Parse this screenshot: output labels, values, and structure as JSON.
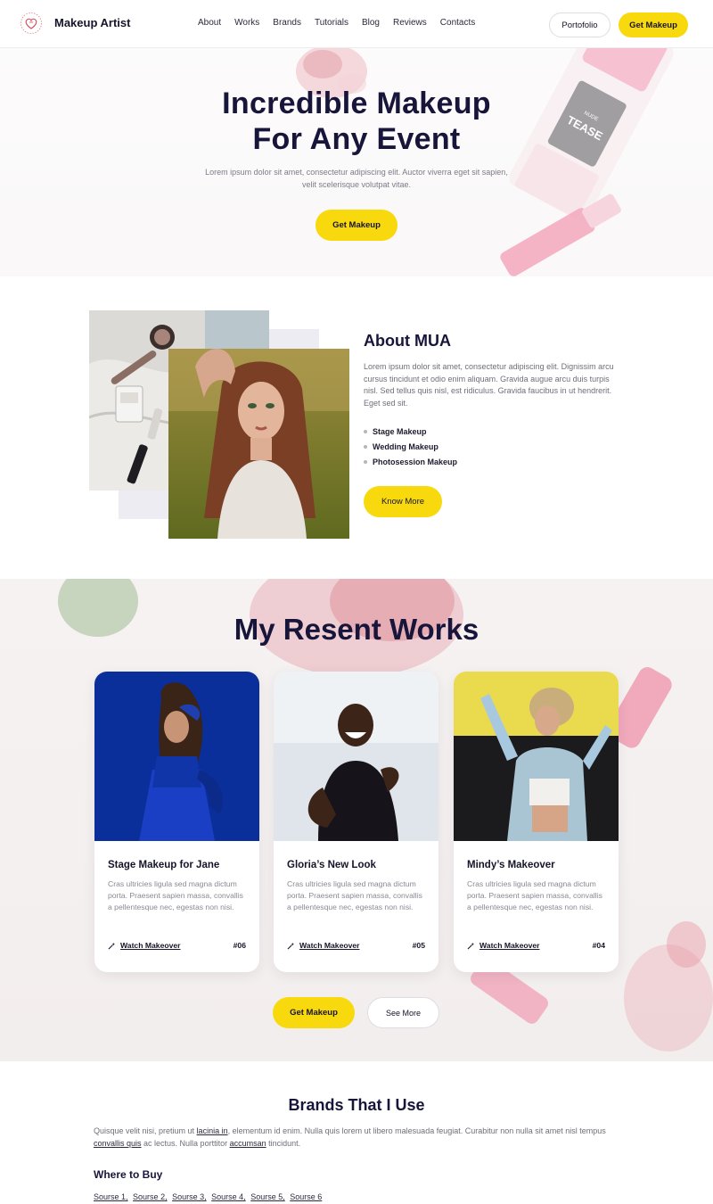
{
  "header": {
    "brand": "Makeup Artist",
    "logo_icon": "heart-outline-icon",
    "nav": [
      "About",
      "Works",
      "Brands",
      "Tutorials",
      "Blog",
      "Reviews",
      "Contacts"
    ],
    "portfolio_label": "Portofolio",
    "get_makeup_label": "Get Makeup"
  },
  "hero": {
    "title_line1": "Incredible Makeup",
    "title_line2": "For Any Event",
    "subtitle": "Lorem ipsum dolor sit amet, consectetur adipiscing elit. Auctor viverra eget sit sapien, velit scelerisque volutpat vitae.",
    "cta_label": "Get Makeup",
    "product_label": "TEASE"
  },
  "about": {
    "title": "About MUA",
    "text": "Lorem ipsum dolor sit amet, consectetur adipiscing elit. Dignissim arcu cursus tincidunt et odio enim aliquam. Gravida augue arcu duis turpis nisl. Sed tellus quis nisl, est ridiculus. Gravida faucibus in ut hendrerit. Eget sed sit.",
    "list": [
      "Stage Makeup",
      "Wedding Makeup",
      "Photosession Makeup"
    ],
    "cta_label": "Know More"
  },
  "works": {
    "title": "My Resent Works",
    "cards": [
      {
        "title": "Stage Makeup for Jane",
        "text": "Cras ultricies ligula sed magna dictum porta. Praesent sapien massa, convallis a pellentesque nec, egestas non nisi.",
        "link": "Watch Makeover",
        "number": "#06"
      },
      {
        "title": "Gloria’s New Look",
        "text": "Cras ultricies ligula sed magna dictum porta. Praesent sapien massa, convallis a pellentesque nec, egestas non nisi.",
        "link": "Watch Makeover",
        "number": "#05"
      },
      {
        "title": "Mindy’s Makeover",
        "text": "Cras ultricies ligula sed magna dictum porta. Praesent sapien massa, convallis a pellentesque nec, egestas non nisi.",
        "link": "Watch Makeover",
        "number": "#04"
      }
    ],
    "cta_label": "Get Makeup",
    "see_more_label": "See More"
  },
  "brands": {
    "title": "Brands That I Use",
    "text_a": "Quisque velit nisi, pretium ut ",
    "link_a": "lacinia in",
    "text_b": ", elementum id enim. Nulla quis lorem ut libero malesuada feugiat. Curabitur non nulla sit amet nisl tempus ",
    "link_b": "convallis quis",
    "text_c": " ac lectus. Nulla porttitor ",
    "link_c": "accumsan",
    "text_d": " tincidunt.",
    "where_to_buy": "Where to Buy",
    "sources": [
      "Sourse 1,",
      "Sourse 2,",
      "Sourse 3,",
      "Sourse 4,",
      "Sourse 5,",
      "Sourse 6"
    ]
  },
  "colors": {
    "accent": "#f8d90d",
    "heading": "#17153a",
    "body_text": "#6f6e7a"
  }
}
